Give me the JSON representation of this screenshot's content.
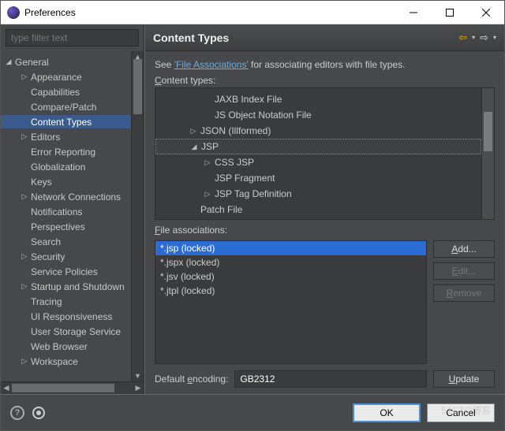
{
  "window": {
    "title": "Preferences"
  },
  "filter": {
    "placeholder": "type filter text"
  },
  "sidebar": {
    "general_label": "General",
    "items": [
      {
        "label": "Appearance",
        "has_children": true,
        "indent": 1
      },
      {
        "label": "Capabilities",
        "has_children": false,
        "indent": 1
      },
      {
        "label": "Compare/Patch",
        "has_children": false,
        "indent": 1
      },
      {
        "label": "Content Types",
        "has_children": false,
        "indent": 1,
        "selected": true
      },
      {
        "label": "Editors",
        "has_children": true,
        "indent": 1
      },
      {
        "label": "Error Reporting",
        "has_children": false,
        "indent": 1
      },
      {
        "label": "Globalization",
        "has_children": false,
        "indent": 1
      },
      {
        "label": "Keys",
        "has_children": false,
        "indent": 1
      },
      {
        "label": "Network Connections",
        "has_children": true,
        "indent": 1
      },
      {
        "label": "Notifications",
        "has_children": false,
        "indent": 1
      },
      {
        "label": "Perspectives",
        "has_children": false,
        "indent": 1
      },
      {
        "label": "Search",
        "has_children": false,
        "indent": 1
      },
      {
        "label": "Security",
        "has_children": true,
        "indent": 1
      },
      {
        "label": "Service Policies",
        "has_children": false,
        "indent": 1
      },
      {
        "label": "Startup and Shutdown",
        "has_children": true,
        "indent": 1
      },
      {
        "label": "Tracing",
        "has_children": false,
        "indent": 1
      },
      {
        "label": "UI Responsiveness",
        "has_children": false,
        "indent": 1
      },
      {
        "label": "User Storage Service",
        "has_children": false,
        "indent": 1
      },
      {
        "label": "Web Browser",
        "has_children": false,
        "indent": 1
      },
      {
        "label": "Workspace",
        "has_children": true,
        "indent": 1
      }
    ]
  },
  "header": {
    "title": "Content Types"
  },
  "content": {
    "intro_prefix": "See ",
    "intro_link": "'File Associations'",
    "intro_suffix": " for associating editors with file types.",
    "content_types_label": "Content types:",
    "file_assoc_label": "File associations:",
    "default_encoding_label": "Default encoding:",
    "encoding_value": "GB2312"
  },
  "content_types_tree": [
    {
      "label": "JAXB Index File",
      "indent": 3,
      "exp": ""
    },
    {
      "label": "JS Object Notation File",
      "indent": 3,
      "exp": ""
    },
    {
      "label": "JSON (Illformed)",
      "indent": 2,
      "exp": "▷"
    },
    {
      "label": "JSP",
      "indent": 2,
      "exp": "◢",
      "selected": true
    },
    {
      "label": "CSS JSP",
      "indent": 3,
      "exp": "▷"
    },
    {
      "label": "JSP Fragment",
      "indent": 3,
      "exp": ""
    },
    {
      "label": "JSP Tag Definition",
      "indent": 3,
      "exp": "▷"
    },
    {
      "label": "Patch File",
      "indent": 2,
      "exp": ""
    }
  ],
  "file_assoc": [
    {
      "label": "*.jsp (locked)",
      "selected": true
    },
    {
      "label": "*.jspx (locked)",
      "selected": false
    },
    {
      "label": "*.jsv (locked)",
      "selected": false
    },
    {
      "label": "*.jtpl (locked)",
      "selected": false
    }
  ],
  "buttons": {
    "add": "Add...",
    "edit": "Edit...",
    "remove": "Remove",
    "update": "Update",
    "ok": "OK",
    "cancel": "Cancel"
  },
  "watermark": "51CTO博客"
}
